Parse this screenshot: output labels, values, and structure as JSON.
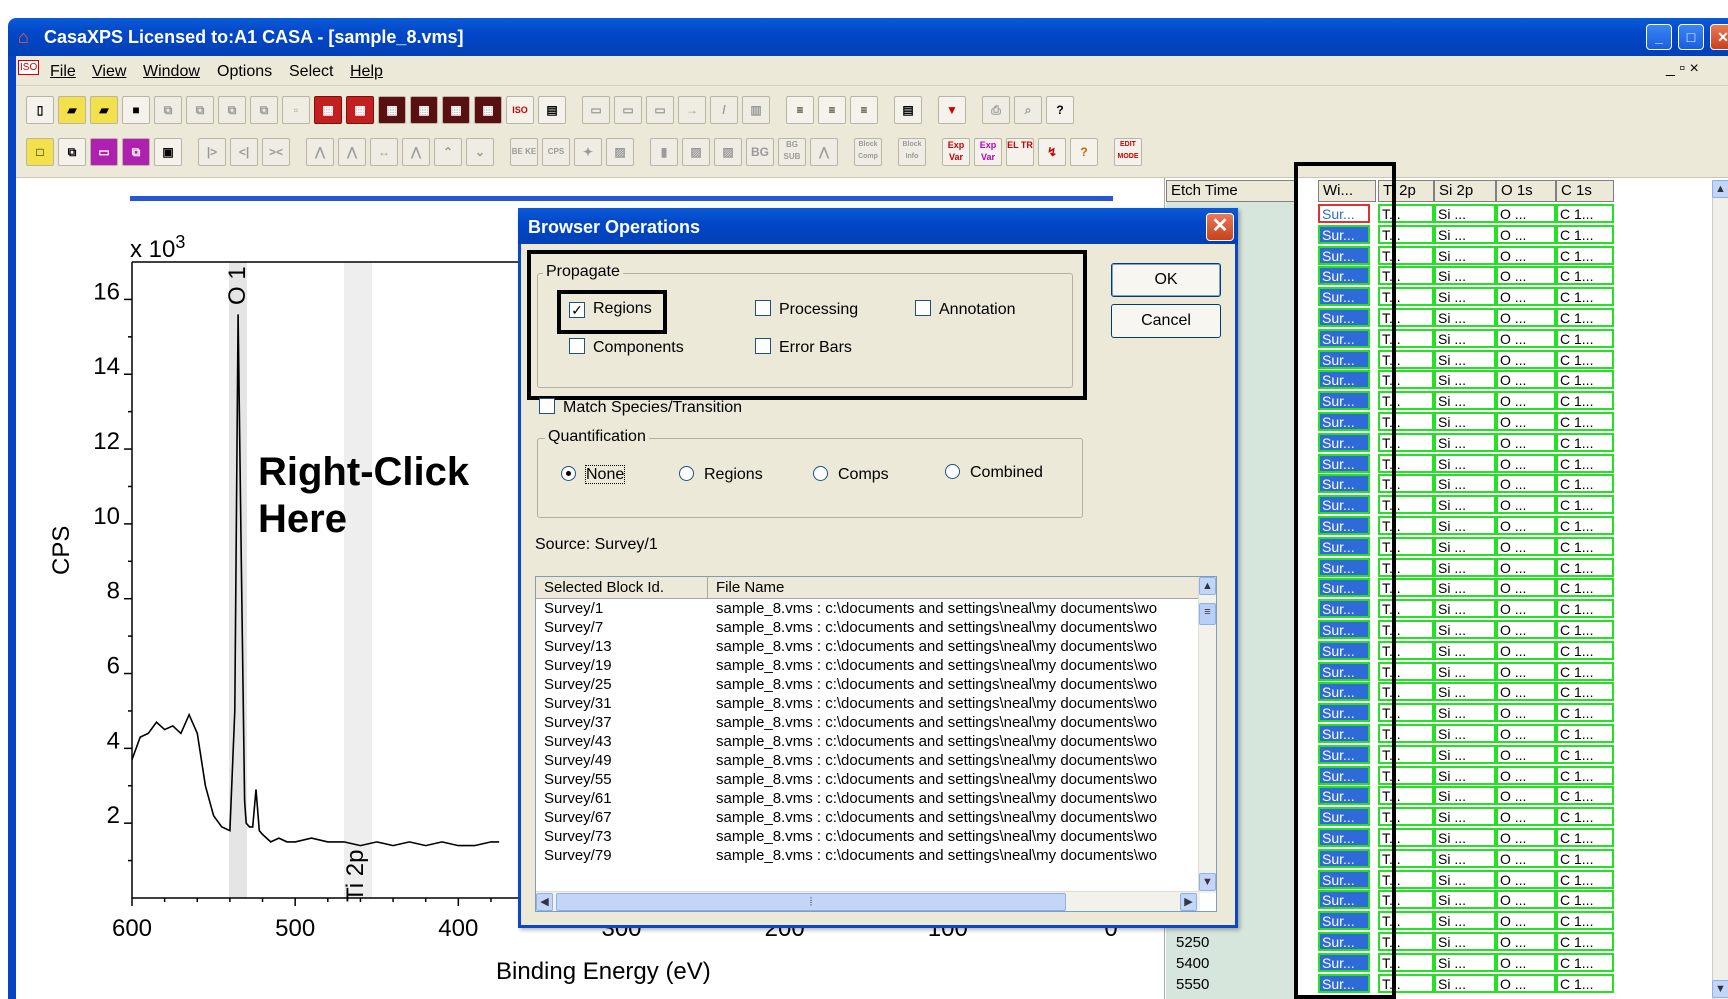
{
  "window": {
    "title": "CasaXPS Licensed to:A1 CASA - [sample_8.vms]"
  },
  "menu": {
    "file": "File",
    "view": "View",
    "window": "Window",
    "options": "Options",
    "select": "Select",
    "help": "Help"
  },
  "toolbar": {
    "row2_text_buttons": [
      "BG",
      "BG SUB",
      "Block Comp",
      "Block Info",
      "Exp Var",
      "Exp Var",
      "EL TR",
      "EDIT MODE"
    ]
  },
  "graph": {
    "multiplier": "x 10",
    "multiplier_exp": "3",
    "ylabel": "CPS",
    "xlabel": "Binding Energy (eV)",
    "annotation_line1": "Right-Click",
    "annotation_line2": "Here",
    "peak_o1s": "O 1",
    "peak_ti2p": "Ti 2p"
  },
  "chart_data": {
    "type": "line",
    "title": "",
    "xlabel": "Binding Energy (eV)",
    "ylabel": "CPS",
    "x_reversed": true,
    "xlim": [
      600,
      0
    ],
    "ylim": [
      0,
      17
    ],
    "y_multiplier": "x 10^3",
    "x_ticks": [
      "600",
      "500",
      "400",
      "300",
      "200",
      "100",
      "0"
    ],
    "y_ticks": [
      "2",
      "4",
      "6",
      "8",
      "10",
      "12",
      "14",
      "16"
    ],
    "series": [
      {
        "x": [
          600,
          595,
          590,
          585,
          580,
          575,
          570,
          565,
          560,
          555,
          550,
          545,
          540,
          537,
          535,
          533,
          531,
          530,
          528,
          526,
          524,
          522,
          520,
          515,
          510,
          505,
          500,
          490,
          480,
          470,
          460,
          450,
          440,
          430,
          420,
          410,
          400,
          390,
          380,
          375
        ],
        "y": [
          3.7,
          4.3,
          4.4,
          4.7,
          4.5,
          4.6,
          4.4,
          4.9,
          4.4,
          3.0,
          2.2,
          1.9,
          1.8,
          5.0,
          15.6,
          9.0,
          2.6,
          2.0,
          1.9,
          1.9,
          2.9,
          1.8,
          1.7,
          1.5,
          1.6,
          1.5,
          1.5,
          1.6,
          1.5,
          1.5,
          1.4,
          1.5,
          1.4,
          1.5,
          1.4,
          1.5,
          1.4,
          1.4,
          1.5,
          1.5
        ]
      }
    ]
  },
  "browser": {
    "headers": [
      "Etch Time",
      "Wi...",
      "Ti 2p",
      "Si 2p",
      "O 1s",
      "C 1s"
    ],
    "cell_values": [
      "Sur...",
      "T...",
      "Si ...",
      "O ...",
      "C 1..."
    ],
    "visible_rows": 38,
    "etch_values": [
      "5250",
      "5400",
      "5550"
    ]
  },
  "dialog": {
    "title": "Browser Operations",
    "propagate_label": "Propagate",
    "regions": "Regions",
    "regions_checked": true,
    "processing": "Processing",
    "annotation": "Annotation",
    "components": "Components",
    "error_bars": "Error Bars",
    "match_species": "Match Species/Transition",
    "quantification_label": "Quantification",
    "q_none": "None",
    "q_regions": "Regions",
    "q_comps": "Comps",
    "q_combined": "Combined",
    "q_selected": "None",
    "ok": "OK",
    "cancel": "Cancel",
    "source": "Source: Survey/1",
    "list_headers": [
      "Selected Block Id.",
      "File Name"
    ],
    "file_name": "sample_8.vms : c:\\documents and settings\\neal\\my documents\\wo",
    "rows": [
      "Survey/1",
      "Survey/7",
      "Survey/13",
      "Survey/19",
      "Survey/25",
      "Survey/31",
      "Survey/37",
      "Survey/43",
      "Survey/49",
      "Survey/55",
      "Survey/61",
      "Survey/67",
      "Survey/73",
      "Survey/79"
    ]
  }
}
